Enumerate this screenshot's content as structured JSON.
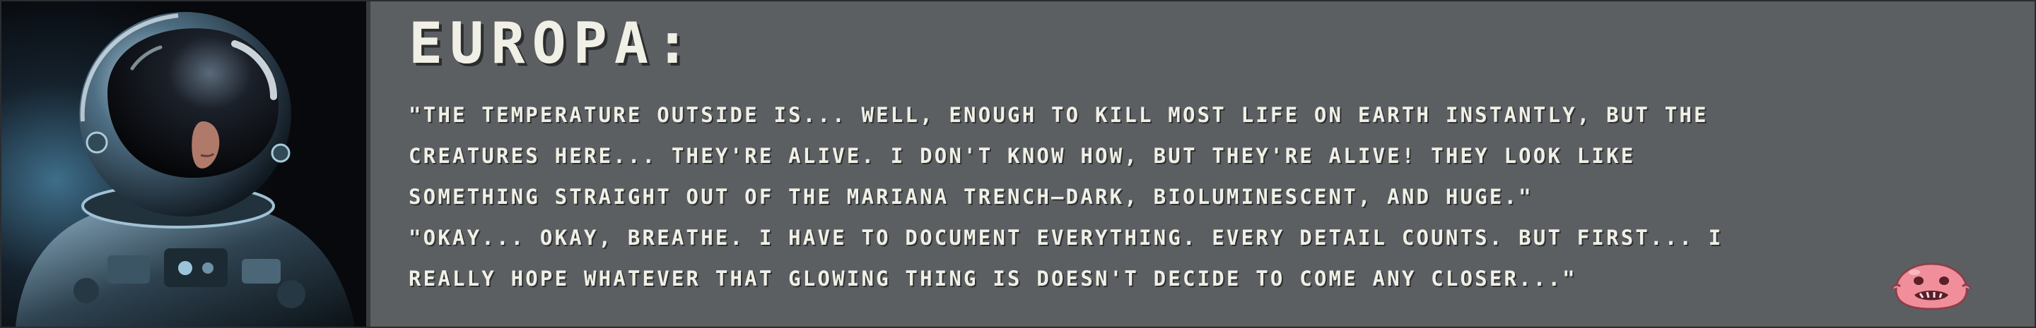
{
  "dialog": {
    "speaker": "EUROPA:",
    "lines": [
      "\"THE TEMPERATURE OUTSIDE IS... WELL, ENOUGH TO KILL MOST LIFE ON EARTH INSTANTLY, BUT THE",
      "CREATURES HERE... THEY'RE ALIVE. I DON'T KNOW HOW, BUT THEY'RE ALIVE! THEY LOOK LIKE",
      "SOMETHING STRAIGHT OUT OF THE MARIANA TRENCH—DARK, BIOLUMINESCENT, AND HUGE.\"",
      "\"OKAY... OKAY, BREATHE. I HAVE TO DOCUMENT EVERYTHING. EVERY DETAIL COUNTS. BUT FIRST... I",
      "REALLY HOPE WHATEVER THAT GLOWING THING IS DOESN'T DECIDE TO COME ANY CLOSER...\""
    ]
  },
  "colors": {
    "panel": "#5b5f62",
    "text": "#f1f0e6",
    "mascot": "#f08f9b"
  },
  "icons": {
    "portrait": "astronaut-portrait",
    "continue": "pink-blob-creature-icon"
  }
}
